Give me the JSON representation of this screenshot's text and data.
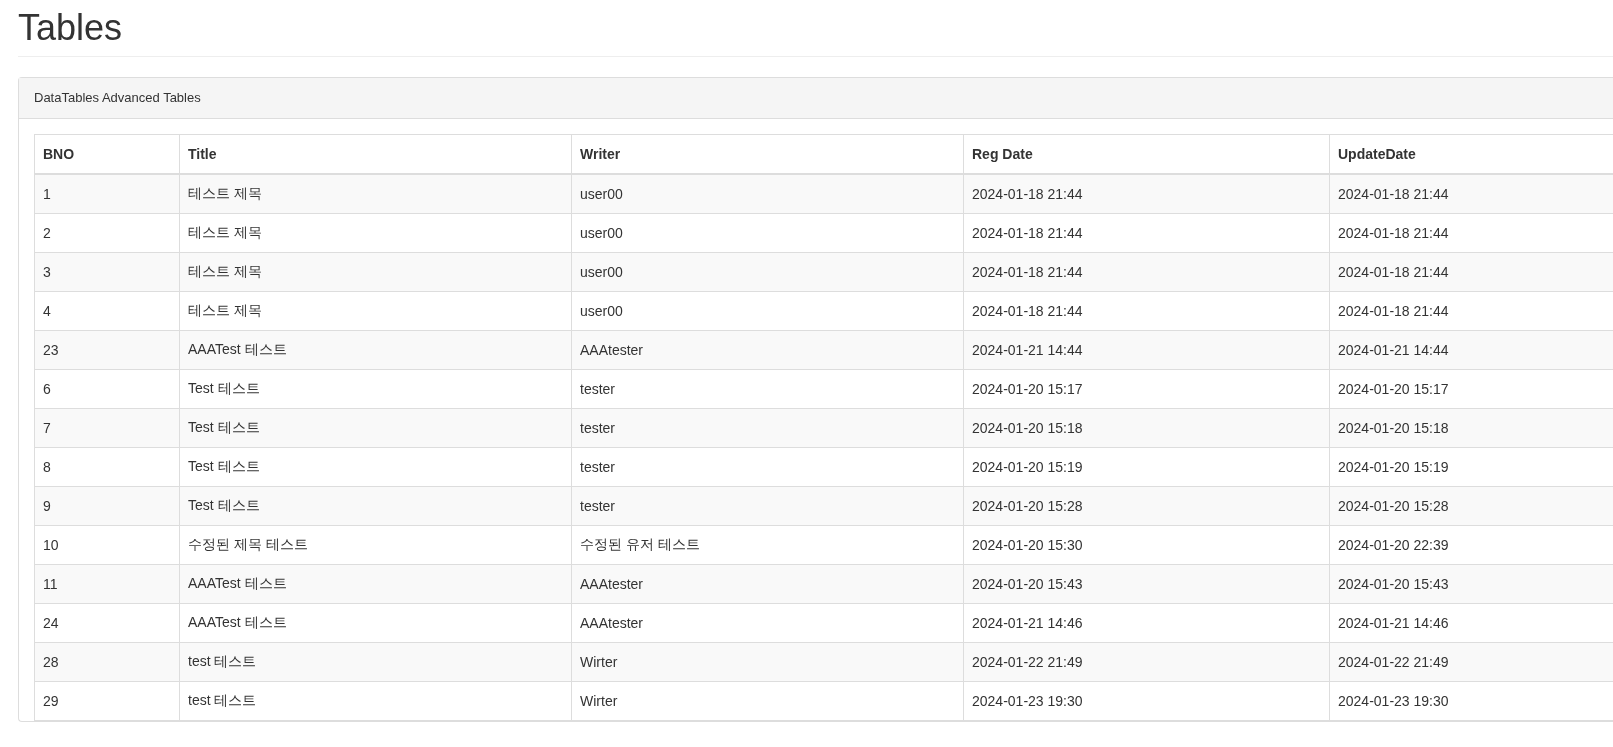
{
  "page_title": "Tables",
  "panel": {
    "heading": "DataTables Advanced Tables"
  },
  "table": {
    "columns": [
      "BNO",
      "Title",
      "Writer",
      "Reg Date",
      "UpdateDate"
    ],
    "rows": [
      [
        "1",
        "테스트 제목",
        "user00",
        "2024-01-18 21:44",
        "2024-01-18 21:44"
      ],
      [
        "2",
        "테스트 제목",
        "user00",
        "2024-01-18 21:44",
        "2024-01-18 21:44"
      ],
      [
        "3",
        "테스트 제목",
        "user00",
        "2024-01-18 21:44",
        "2024-01-18 21:44"
      ],
      [
        "4",
        "테스트 제목",
        "user00",
        "2024-01-18 21:44",
        "2024-01-18 21:44"
      ],
      [
        "23",
        "AAATest 테스트",
        "AAAtester",
        "2024-01-21 14:44",
        "2024-01-21 14:44"
      ],
      [
        "6",
        "Test 테스트",
        "tester",
        "2024-01-20 15:17",
        "2024-01-20 15:17"
      ],
      [
        "7",
        "Test 테스트",
        "tester",
        "2024-01-20 15:18",
        "2024-01-20 15:18"
      ],
      [
        "8",
        "Test 테스트",
        "tester",
        "2024-01-20 15:19",
        "2024-01-20 15:19"
      ],
      [
        "9",
        "Test 테스트",
        "tester",
        "2024-01-20 15:28",
        "2024-01-20 15:28"
      ],
      [
        "10",
        "수정된 제목 테스트",
        "수정된 유저 테스트",
        "2024-01-20 15:30",
        "2024-01-20 22:39"
      ],
      [
        "11",
        "AAATest 테스트",
        "AAAtester",
        "2024-01-20 15:43",
        "2024-01-20 15:43"
      ],
      [
        "24",
        "AAATest 테스트",
        "AAAtester",
        "2024-01-21 14:46",
        "2024-01-21 14:46"
      ],
      [
        "28",
        "test 테스트",
        "Wirter",
        "2024-01-22 21:49",
        "2024-01-22 21:49"
      ],
      [
        "29",
        "test 테스트",
        "Wirter",
        "2024-01-23 19:30",
        "2024-01-23 19:30"
      ]
    ]
  }
}
